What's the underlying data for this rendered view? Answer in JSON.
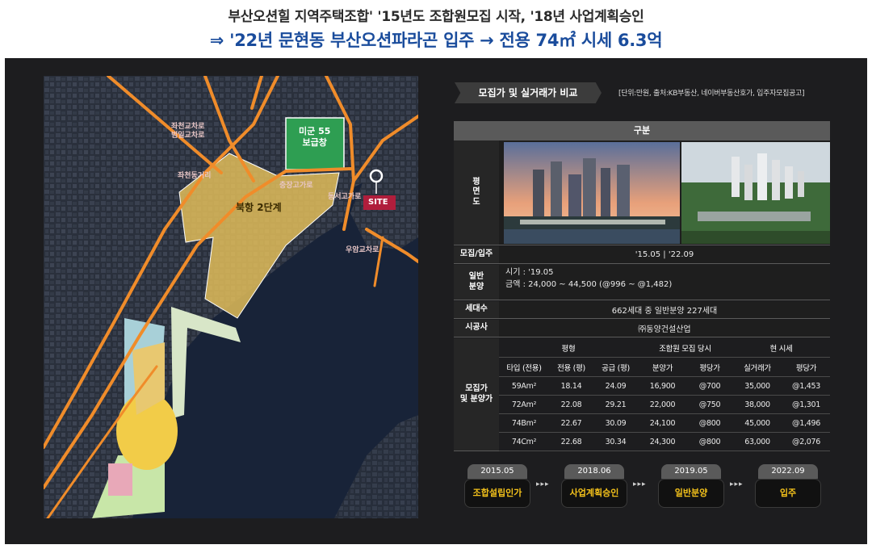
{
  "header": {
    "line1": "부산오션힐 지역주택조합' '15년도 조합원모집 시작, '18년 사업계획승인",
    "line2": "⇒ '22년 문현동 부산오션파라곤 입주 → 전용 74㎡ 시세 6.3억"
  },
  "map": {
    "labels": {
      "park": "미군 55\n보급창",
      "zone": "북항 2단계",
      "site": "SITE",
      "road1": "좌천교차로\n범일교차로",
      "road2": "좌천동거리",
      "road3": "충장고가로",
      "road4": "동서고가로",
      "road5": "우암교차로"
    },
    "colors": {
      "zone": "#e8c25a",
      "park": "#2e9e52",
      "roads": "#f08c2a",
      "site": "#b01e3c"
    }
  },
  "table": {
    "title": "모집가 및 실거래가 비교",
    "source": "[단위:만원, 출처:KB부동산, 네이버부동산호가, 입주자모집공고]",
    "header": "구분",
    "rows": {
      "perspective_label": "평\n면\n도",
      "recruit_label": "모집/입주",
      "recruit_value": "'15.05 | '22.09",
      "sale_label": "일반\n분양",
      "sale_value_1": "시기 : '19.05",
      "sale_value_2": "금액 :  24,000 ~ 44,500 (@996 ~ @1,482)",
      "households_label": "세대수",
      "households_value": "662세대 중 일반분양 227세대",
      "builder_label": "시공사",
      "builder_value": "㈜동양건설산업",
      "price_label": "모집가\n및 분양가"
    },
    "price": {
      "groups": [
        "평형",
        "조합원 모집 당시",
        "현 시세"
      ],
      "columns": [
        "타입 (전용)",
        "전용 (평)",
        "공급 (평)",
        "분양가",
        "평당가",
        "실거래가",
        "평당가"
      ],
      "data": [
        [
          "59Am²",
          "18.14",
          "24.09",
          "16,900",
          "@700",
          "35,000",
          "@1,453"
        ],
        [
          "72Am²",
          "22.08",
          "29.21",
          "22,000",
          "@750",
          "38,000",
          "@1,301"
        ],
        [
          "74Bm²",
          "22.67",
          "30.09",
          "24,100",
          "@800",
          "45,000",
          "@1,496"
        ],
        [
          "74Cm²",
          "22.68",
          "30.34",
          "24,300",
          "@800",
          "63,000",
          "@2,076"
        ]
      ]
    }
  },
  "timeline": {
    "steps": [
      {
        "year": "2015.05",
        "name": "조합설립인가"
      },
      {
        "year": "2018.06",
        "name": "사업계획승인"
      },
      {
        "year": "2019.05",
        "name": "일반분양"
      },
      {
        "year": "2022.09",
        "name": "입주"
      }
    ],
    "arrow": "▸▸▸"
  }
}
